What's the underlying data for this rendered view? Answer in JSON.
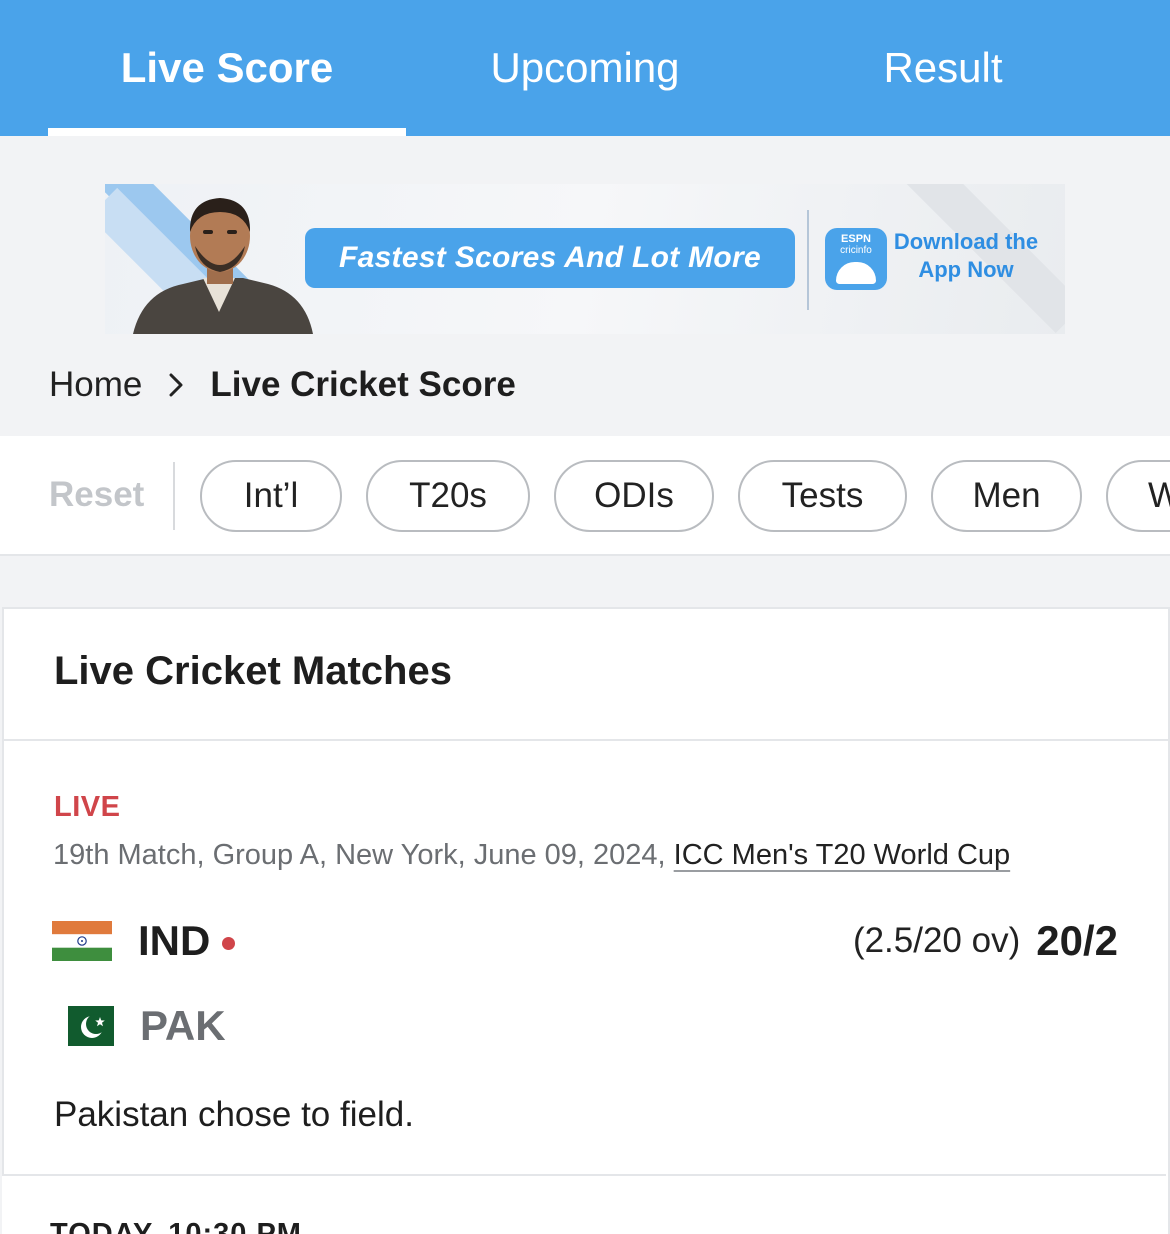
{
  "tabs": [
    {
      "label": "Live Score",
      "active": true
    },
    {
      "label": "Upcoming",
      "active": false
    },
    {
      "label": "Result",
      "active": false
    }
  ],
  "banner": {
    "headline": "Fastest Scores And Lot More",
    "logo_text": "ESPN cricinfo",
    "cta_line1": "Download the",
    "cta_line2": "App Now"
  },
  "breadcrumb": {
    "home": "Home",
    "current": "Live Cricket Score"
  },
  "filters": {
    "reset": "Reset",
    "chips": [
      "Int’l",
      "T20s",
      "ODIs",
      "Tests",
      "Men",
      "W"
    ]
  },
  "section": {
    "title": "Live Cricket Matches"
  },
  "match": {
    "status_tag": "LIVE",
    "meta": "19th Match, Group A, New York, June 09, 2024, ",
    "series": "ICC Men's T20 World Cup",
    "team1": {
      "code": "IND",
      "overs": "(2.5/20 ov)",
      "score": "20/2",
      "batting": true
    },
    "team2": {
      "code": "PAK"
    },
    "status_text": "Pakistan chose to field."
  },
  "next_match": {
    "label": "TODAY, 10:30 PM"
  },
  "colors": {
    "brand_blue": "#4aa3ea",
    "live_red": "#d0454a"
  }
}
